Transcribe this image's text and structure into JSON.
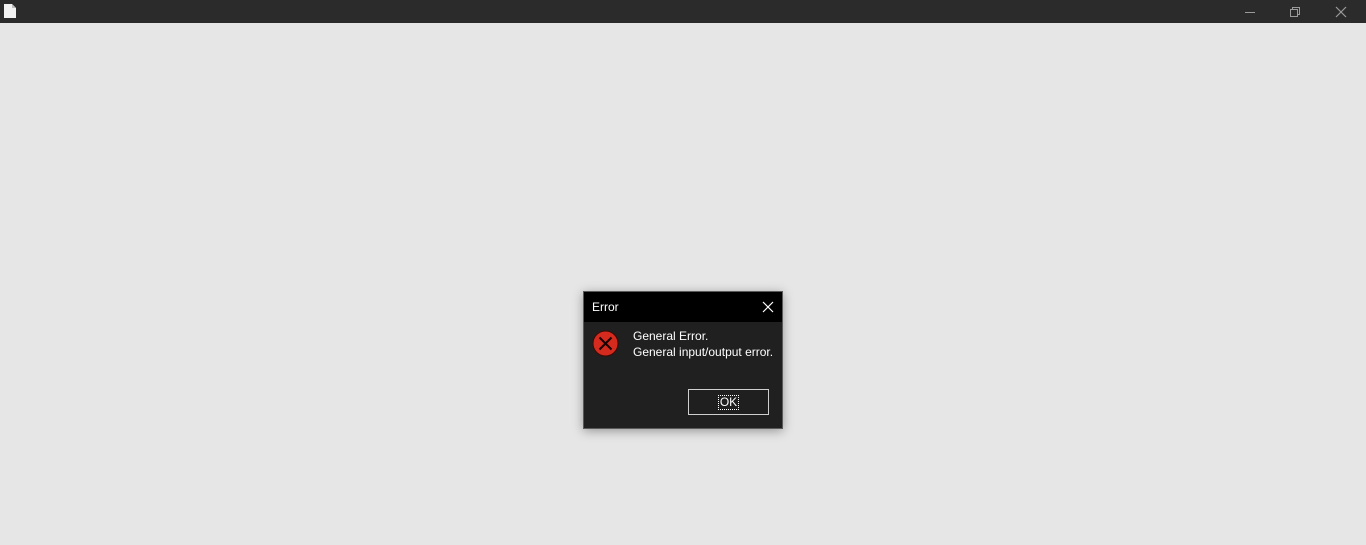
{
  "window": {
    "icon": "document-icon",
    "controls": [
      "minimize-icon",
      "restore-icon",
      "close-icon"
    ]
  },
  "dialog": {
    "title": "Error",
    "icon": "error-icon",
    "message_line1": "General Error.",
    "message_line2": "General input/output error.",
    "ok_label": "OK"
  },
  "colors": {
    "window_titlebar": "#2b2b2b",
    "desktop": "#e6e6e6",
    "dialog_background": "#202020",
    "dialog_titlebar": "#000000",
    "error_red": "#d52b1e"
  }
}
